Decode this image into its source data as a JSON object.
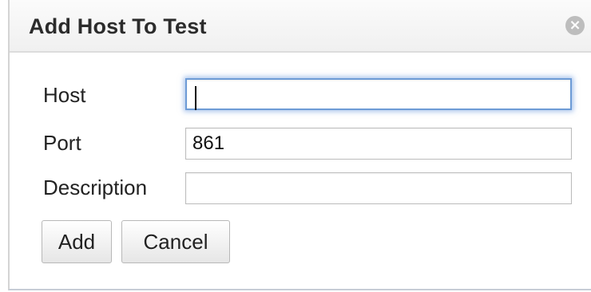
{
  "dialog": {
    "title": "Add Host To Test",
    "close_icon_glyph": "×",
    "fields": {
      "host": {
        "label": "Host",
        "value": ""
      },
      "port": {
        "label": "Port",
        "value": "861"
      },
      "description": {
        "label": "Description",
        "value": ""
      }
    },
    "buttons": {
      "add": "Add",
      "cancel": "Cancel"
    }
  },
  "colors": {
    "focus_ring": "#6d9bd6",
    "close_icon_bg": "#bdbdbd"
  },
  "icons": {
    "close": "close-icon"
  }
}
